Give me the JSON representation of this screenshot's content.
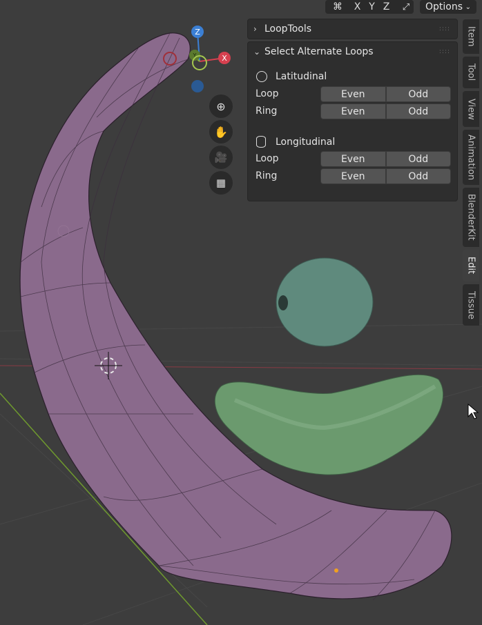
{
  "header": {
    "axes": [
      "X",
      "Y",
      "Z"
    ],
    "options_label": "Options",
    "options_chevron": "chevron-down-icon"
  },
  "gizmo": {
    "z": "Z",
    "x": "X",
    "y": "Y"
  },
  "panels": {
    "looptools": {
      "title": "LoopTools",
      "collapsed": true
    },
    "select_alternate": {
      "title": "Select Alternate Loops",
      "latitudinal": {
        "label": "Latitudinal",
        "loop_label": "Loop",
        "ring_label": "Ring",
        "even": "Even",
        "odd": "Odd"
      },
      "longitudinal": {
        "label": "Longitudinal",
        "loop_label": "Loop",
        "ring_label": "Ring",
        "even": "Even",
        "odd": "Odd"
      }
    }
  },
  "sidebar_tabs": [
    "Item",
    "Tool",
    "View",
    "Animation",
    "BlenderKit",
    "Edit",
    "Tissue"
  ],
  "active_tab": "Edit",
  "colors": {
    "banana": "#8a6a8c",
    "green_object": "#5e8a6b",
    "x_axis": "#d6404f",
    "y_axis": "#86b33b",
    "z_axis": "#3b7fd4",
    "panel_bg": "#2e2e2e",
    "button_bg": "#545454"
  }
}
